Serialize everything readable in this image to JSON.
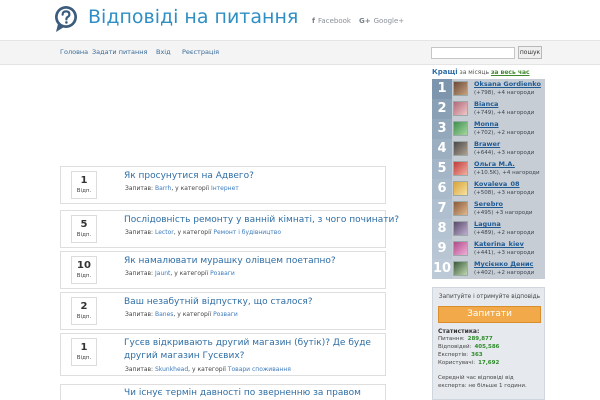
{
  "header": {
    "title": "Відповіді на питання",
    "logo_icon": "question-bubble-icon",
    "social": [
      {
        "label": "Facebook",
        "glyph": "f"
      },
      {
        "label": "Google+",
        "glyph": "G+"
      }
    ]
  },
  "nav": {
    "items": [
      "Головна",
      "Задати питання",
      "Вхід",
      "Реєстрація"
    ],
    "search_button": "пошук",
    "search_value": ""
  },
  "questions": [
    {
      "count": "1",
      "label": "Відп.",
      "title": "Як просунутися на Адвего?",
      "prefix": "Запитав:",
      "user": "Barrh",
      "mid": ", у категорії",
      "category": "Інтернет"
    },
    {
      "count": "5",
      "label": "Відп.",
      "title": "Послідовність ремонту у ванній кімнаті, з чого починати?",
      "prefix": "Запитав:",
      "user": "Lector",
      "mid": ", у категорії",
      "category": "Ремонт і будівництво"
    },
    {
      "count": "10",
      "label": "Відп.",
      "title": "Як намалювати мурашку олівцем поетапно?",
      "prefix": "Запитав:",
      "user": "Jaunt",
      "mid": ", у категорії",
      "category": "Розваги"
    },
    {
      "count": "2",
      "label": "Відп.",
      "title": "Ваш незабутній відпустку, що сталося?",
      "prefix": "Запитав:",
      "user": "Banes",
      "mid": ", у категорії",
      "category": "Розваги"
    },
    {
      "count": "1",
      "label": "Відп.",
      "title": "Гусєв відкривають другий магазин (бутік)? Де буде другий магазин Гусєвих?",
      "prefix": "Запитав:",
      "user": "Skunkhead",
      "mid": ", у категорії",
      "category": "Товари споживання"
    },
    {
      "count": "",
      "label": "",
      "title": "Чи існує термін давності по зверненню за правом",
      "prefix": "",
      "user": "",
      "mid": "",
      "category": ""
    }
  ],
  "sidebar": {
    "title": "Кращі",
    "period_label": "за місяць",
    "all_time": "за весь час",
    "ranking": [
      {
        "rank": "1",
        "name": "Oksana Gordienko",
        "sub": "(+798), +4 нагороди",
        "bg": "#7d96ad"
      },
      {
        "rank": "2",
        "name": "Bianca",
        "sub": "(+749), +4 нагороди",
        "bg": "#8aa0b4"
      },
      {
        "rank": "3",
        "name": "Monna",
        "sub": "(+702), +2 нагороди",
        "bg": "#94a8bb"
      },
      {
        "rank": "4",
        "name": "Brawer",
        "sub": "(+644), +3 нагороди",
        "bg": "#9cafc1"
      },
      {
        "rank": "5",
        "name": "Ольга М.А.",
        "sub": "(+10.5K), +4 нагороди",
        "bg": "#a3b5c6"
      },
      {
        "rank": "6",
        "name": "Kovaleva_08",
        "sub": "(+508), +3 нагороди",
        "bg": "#a9bacb"
      },
      {
        "rank": "7",
        "name": "Serebro",
        "sub": "(+495) +3 нагороди",
        "bg": "#afbfcf"
      },
      {
        "rank": "8",
        "name": "Laguna",
        "sub": "(+489), +2 нагороди",
        "bg": "#b4c3d2"
      },
      {
        "rank": "9",
        "name": "Katerina_kiev",
        "sub": "(+441), +3 нагороди",
        "bg": "#b8c6d4"
      },
      {
        "rank": "10",
        "name": "Мусієнко Денис",
        "sub": "(+402), +2 нагороди",
        "bg": "#bccad7"
      }
    ],
    "ask": {
      "prompt": "Запитуйте і отримуйте відповідь",
      "button": "Запитати",
      "stats_title": "Статистика:",
      "stats": [
        {
          "label": "Питання:",
          "value": "289,877"
        },
        {
          "label": "Відповідей:",
          "value": "405,586"
        },
        {
          "label": "Експертів:",
          "value": "363"
        },
        {
          "label": "Користувачі:",
          "value": "17,692"
        }
      ],
      "note": "Середній час відповіді від експерта: не більше 1 години."
    }
  }
}
